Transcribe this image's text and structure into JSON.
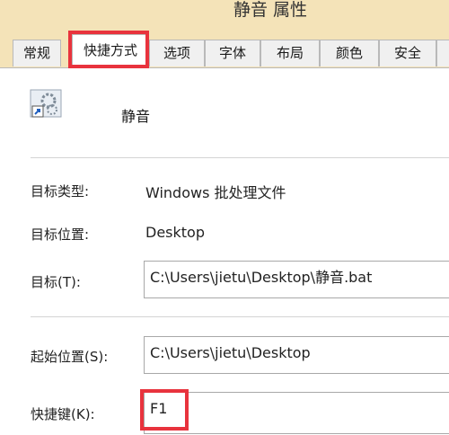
{
  "window": {
    "title": "静音 属性"
  },
  "tabs": [
    {
      "label": "常规"
    },
    {
      "label": "快捷方式"
    },
    {
      "label": "选项"
    },
    {
      "label": "字体"
    },
    {
      "label": "布局"
    },
    {
      "label": "颜色"
    },
    {
      "label": "安全"
    }
  ],
  "shortcut": {
    "name": "静音",
    "icon": "batch-file-shortcut-icon",
    "target_type_label": "目标类型:",
    "target_type_value": "Windows 批处理文件",
    "target_location_label": "目标位置:",
    "target_location_value": "Desktop",
    "target_label": "目标(T):",
    "target_value": "C:\\Users\\jietu\\Desktop\\静音.bat",
    "start_in_label": "起始位置(S):",
    "start_in_value": "C:\\Users\\jietu\\Desktop",
    "hotkey_label": "快捷键(K):",
    "hotkey_value": "F1"
  },
  "colors": {
    "highlight": "#e8333d",
    "titlebar": "#f4e3b8"
  }
}
